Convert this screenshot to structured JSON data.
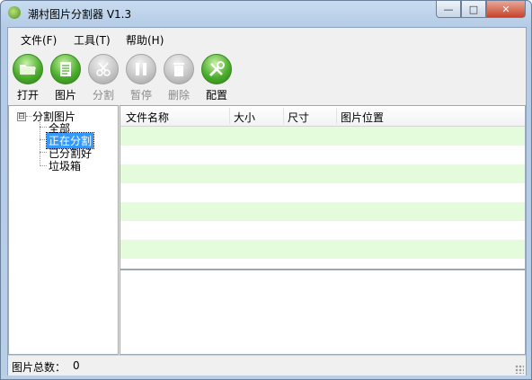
{
  "window": {
    "title": "潮村图片分割器 V1.3",
    "controls": {
      "minimize": "—",
      "maximize": "□",
      "close": "✕"
    }
  },
  "menu": {
    "items": [
      {
        "label": "文件(F)"
      },
      {
        "label": "工具(T)"
      },
      {
        "label": "帮助(H)"
      }
    ]
  },
  "toolbar": {
    "buttons": [
      {
        "label": "打开",
        "icon": "folder-open-icon",
        "enabled": true
      },
      {
        "label": "图片",
        "icon": "document-icon",
        "enabled": true
      },
      {
        "label": "分割",
        "icon": "scissors-icon",
        "enabled": false
      },
      {
        "label": "暂停",
        "icon": "pause-icon",
        "enabled": false
      },
      {
        "label": "删除",
        "icon": "trash-icon",
        "enabled": false
      },
      {
        "label": "配置",
        "icon": "tools-icon",
        "enabled": true
      }
    ]
  },
  "tree": {
    "root": {
      "label": "分割图片",
      "expander": "⊟"
    },
    "children": [
      {
        "label": "全部",
        "selected": false
      },
      {
        "label": "正在分割",
        "selected": true
      },
      {
        "label": "已分割好",
        "selected": false
      },
      {
        "label": "垃圾箱",
        "selected": false
      }
    ]
  },
  "table": {
    "columns": [
      "文件名称",
      "大小",
      "尺寸",
      "图片位置"
    ],
    "rows": []
  },
  "status": {
    "label": "图片总数：",
    "value": "0"
  },
  "colors": {
    "row_band": "#e4fbdc",
    "selection": "#3399ff",
    "enabled_icon": "#4cae2e",
    "disabled_icon": "#c7c7c7"
  }
}
